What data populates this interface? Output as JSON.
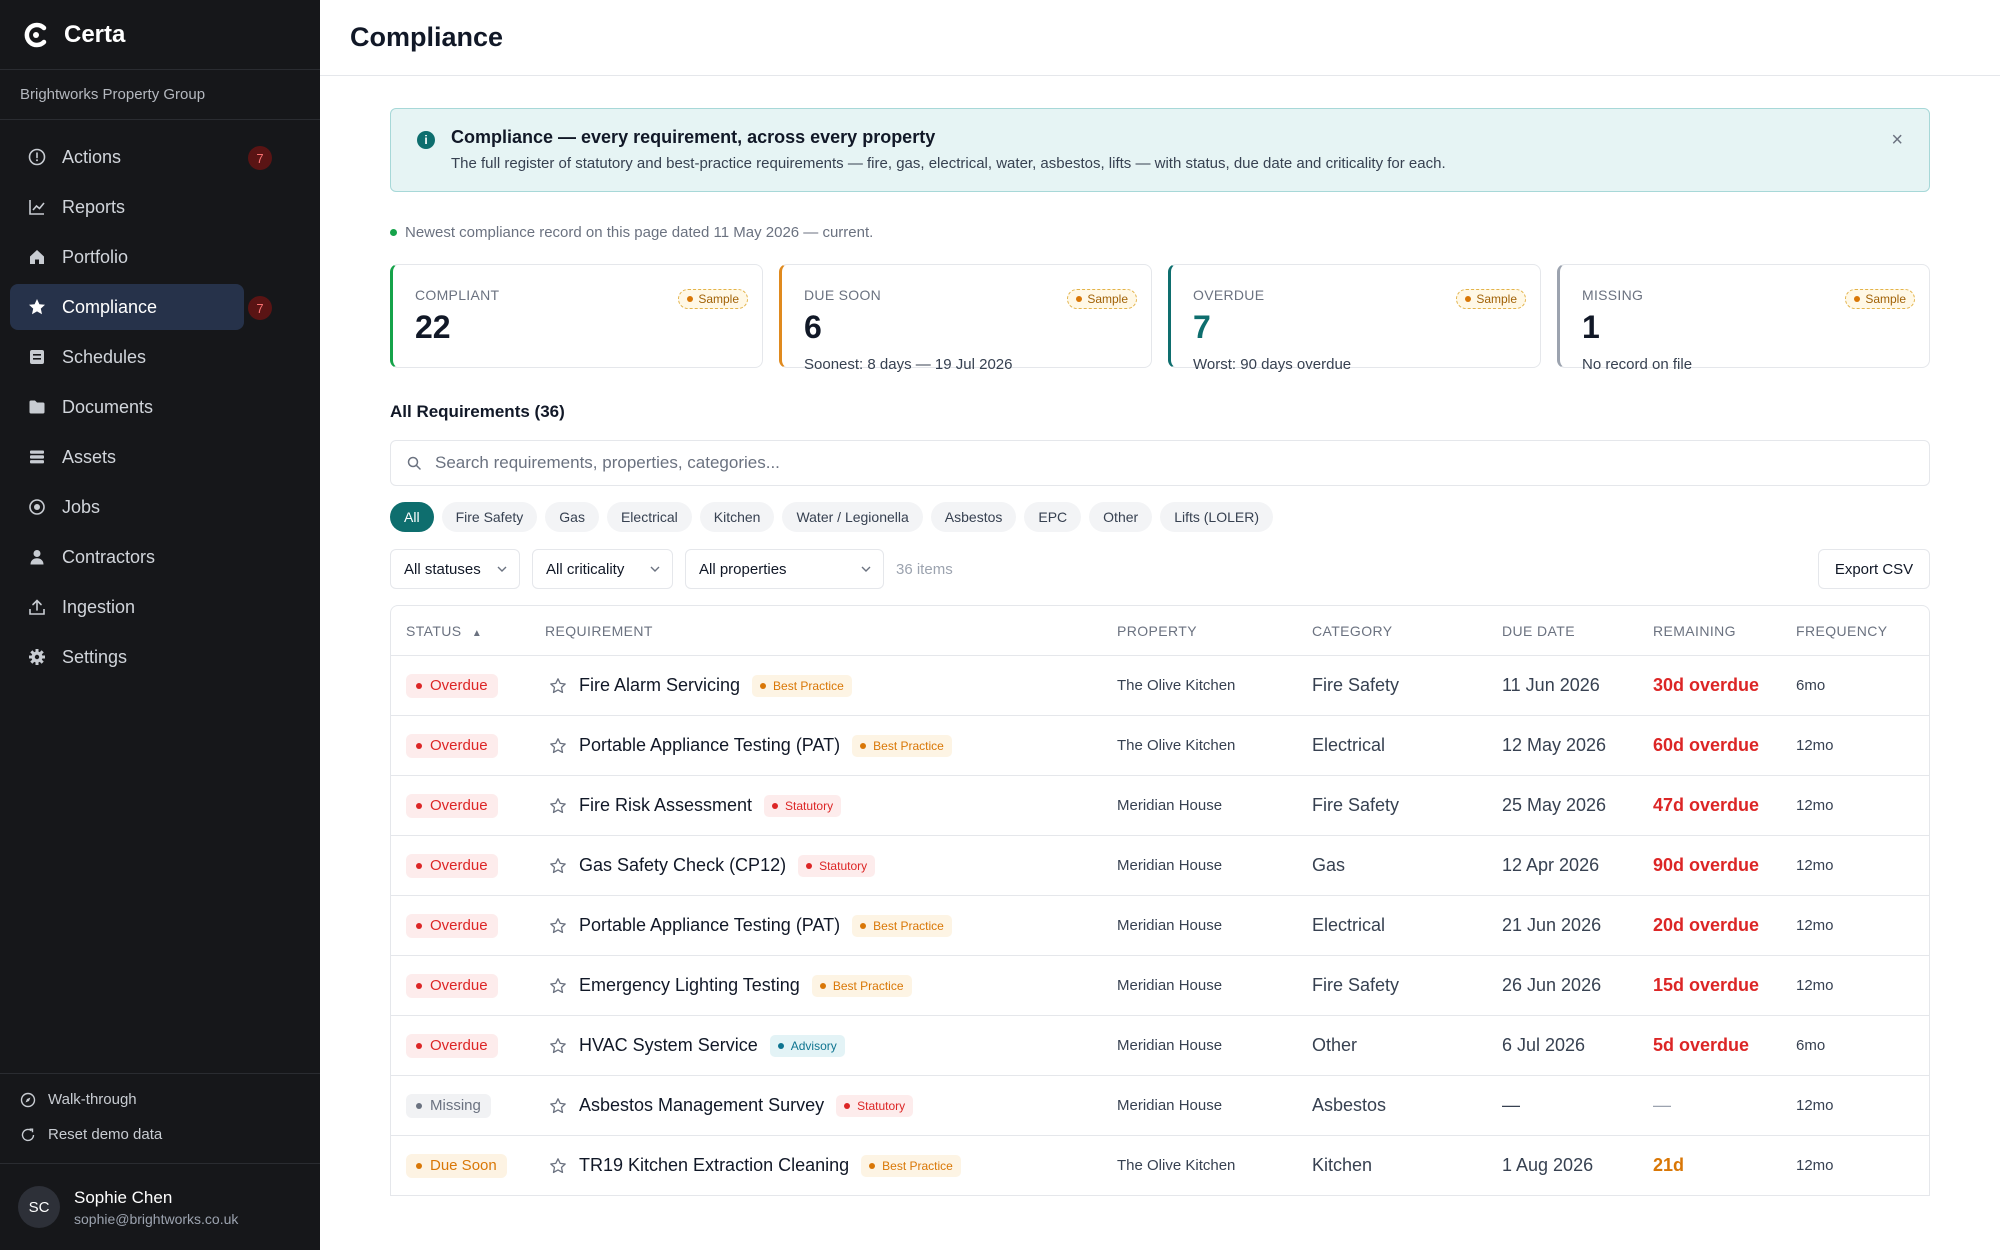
{
  "app": {
    "name": "Certa",
    "org": "Brightworks Property Group"
  },
  "nav": [
    {
      "label": "Actions",
      "icon": "clock-icon",
      "badge": "7"
    },
    {
      "label": "Reports",
      "icon": "chart-icon",
      "badge": ""
    },
    {
      "label": "Portfolio",
      "icon": "home-icon",
      "badge": ""
    },
    {
      "label": "Compliance",
      "icon": "star-icon",
      "badge": "7",
      "active": true
    },
    {
      "label": "Schedules",
      "icon": "calendar-icon",
      "badge": ""
    },
    {
      "label": "Documents",
      "icon": "folder-icon",
      "badge": ""
    },
    {
      "label": "Assets",
      "icon": "stack-icon",
      "badge": ""
    },
    {
      "label": "Jobs",
      "icon": "target-icon",
      "badge": ""
    },
    {
      "label": "Contractors",
      "icon": "user-icon",
      "badge": ""
    },
    {
      "label": "Ingestion",
      "icon": "upload-icon",
      "badge": ""
    },
    {
      "label": "Settings",
      "icon": "gear-icon",
      "badge": ""
    }
  ],
  "utility": {
    "walkthrough": "Walk-through",
    "reset": "Reset demo data"
  },
  "user": {
    "initials": "SC",
    "name": "Sophie Chen",
    "email": "sophie@brightworks.co.uk"
  },
  "page": {
    "title": "Compliance"
  },
  "banner": {
    "icon": "i",
    "title": "Compliance — every requirement, across every property",
    "text": "The full register of statutory and best-practice requirements — fire, gas, electrical, water, asbestos, lifts — with status, due date and criticality for each.",
    "close": "×"
  },
  "freshness": "Newest compliance record on this page dated 11 May 2026 — current.",
  "stats": [
    {
      "label": "COMPLIANT",
      "value": "22",
      "sub": "",
      "sample": "Sample",
      "accent": "#16a34a",
      "value_color": "#111827"
    },
    {
      "label": "DUE SOON",
      "value": "6",
      "sub": "Soonest: 8 days — 19 Jul 2026",
      "sample": "Sample",
      "accent": "#e08a1e",
      "value_color": "#111827"
    },
    {
      "label": "OVERDUE",
      "value": "7",
      "sub": "Worst: 90 days overdue",
      "sample": "Sample",
      "accent": "#0e6e6e",
      "value_color": "#0e6e6e"
    },
    {
      "label": "MISSING",
      "value": "1",
      "sub": "No record on file",
      "sample": "Sample",
      "accent": "#9ca3af",
      "value_color": "#111827"
    }
  ],
  "requirements": {
    "title": "All Requirements (36)",
    "search_placeholder": "Search requirements, properties, categories...",
    "chips": [
      "All",
      "Fire Safety",
      "Gas",
      "Electrical",
      "Kitchen",
      "Water / Legionella",
      "Asbestos",
      "EPC",
      "Other",
      "Lifts (LOLER)"
    ],
    "filters": {
      "status": "All statuses",
      "criticality": "All criticality",
      "properties": "All properties"
    },
    "count": "36 items",
    "export": "Export CSV",
    "columns": {
      "status": "STATUS",
      "requirement": "REQUIREMENT",
      "property": "PROPERTY",
      "category": "CATEGORY",
      "due": "DUE DATE",
      "remaining": "REMAINING",
      "frequency": "FREQUENCY"
    },
    "rows": [
      {
        "status": "Overdue",
        "name": "Fire Alarm Servicing",
        "tag": "Best Practice",
        "property": "The Olive Kitchen",
        "category": "Fire Safety",
        "due": "11 Jun 2026",
        "remaining": "30d overdue",
        "frequency": "6mo"
      },
      {
        "status": "Overdue",
        "name": "Portable Appliance Testing (PAT)",
        "tag": "Best Practice",
        "property": "The Olive Kitchen",
        "category": "Electrical",
        "due": "12 May 2026",
        "remaining": "60d overdue",
        "frequency": "12mo"
      },
      {
        "status": "Overdue",
        "name": "Fire Risk Assessment",
        "tag": "Statutory",
        "property": "Meridian House",
        "category": "Fire Safety",
        "due": "25 May 2026",
        "remaining": "47d overdue",
        "frequency": "12mo"
      },
      {
        "status": "Overdue",
        "name": "Gas Safety Check (CP12)",
        "tag": "Statutory",
        "property": "Meridian House",
        "category": "Gas",
        "due": "12 Apr 2026",
        "remaining": "90d overdue",
        "frequency": "12mo"
      },
      {
        "status": "Overdue",
        "name": "Portable Appliance Testing (PAT)",
        "tag": "Best Practice",
        "property": "Meridian House",
        "category": "Electrical",
        "due": "21 Jun 2026",
        "remaining": "20d overdue",
        "frequency": "12mo"
      },
      {
        "status": "Overdue",
        "name": "Emergency Lighting Testing",
        "tag": "Best Practice",
        "property": "Meridian House",
        "category": "Fire Safety",
        "due": "26 Jun 2026",
        "remaining": "15d overdue",
        "frequency": "12mo"
      },
      {
        "status": "Overdue",
        "name": "HVAC System Service",
        "tag": "Advisory",
        "property": "Meridian House",
        "category": "Other",
        "due": "6 Jul 2026",
        "remaining": "5d overdue",
        "frequency": "6mo"
      },
      {
        "status": "Missing",
        "name": "Asbestos Management Survey",
        "tag": "Statutory",
        "property": "Meridian House",
        "category": "Asbestos",
        "due": "—",
        "remaining": "—",
        "frequency": "12mo"
      },
      {
        "status": "Due Soon",
        "name": "TR19 Kitchen Extraction Cleaning",
        "tag": "Best Practice",
        "property": "The Olive Kitchen",
        "category": "Kitchen",
        "due": "1 Aug 2026",
        "remaining": "21d",
        "frequency": "12mo"
      }
    ]
  },
  "colors": {
    "overdue": "#dc2626",
    "missing": "#6b7280",
    "due_soon": "#d97706",
    "statutory": "#dc2626",
    "best_practice": "#d97706",
    "advisory": "#0e7490",
    "accent": "#0e6e6e"
  }
}
